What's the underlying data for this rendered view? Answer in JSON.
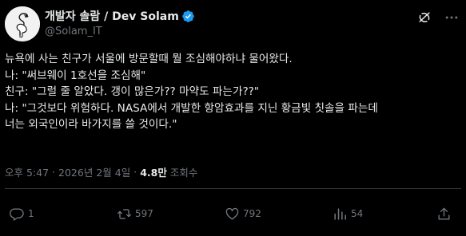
{
  "author": {
    "display_name": "개발자 솔람 / Dev Solam",
    "handle": "@Solam_IT",
    "verified": true,
    "verified_color": "#1d9bf0"
  },
  "tweet": {
    "lines": [
      "뉴욕에 사는 친구가 서울에 방문할때 뭘 조심해야하냐 물어왔다.",
      "나: \"써브웨이 1호선을 조심해\"",
      "친구: \"그럴 줄 알았다. 갱이 많은가?? 마약도 파는가??\"",
      "나: \"그것보다 위험하다. NASA에서 개발한 항암효과를 지닌 황금빛 칫솔을 파는데",
      "너는 외국인이라 바가지를 쓸 것이다.\""
    ]
  },
  "meta": {
    "time": "오후 5:47",
    "date": "2026년 2월 4일",
    "views_count": "4.8만",
    "views_label": "조회수",
    "separator": "·"
  },
  "actions": {
    "reply_count": "1",
    "retweet_count": "597",
    "like_count": "792",
    "views_count": "54",
    "share_count": ""
  },
  "icons": {
    "grok": "grok-icon",
    "more": "more-icon",
    "reply": "reply-icon",
    "retweet": "retweet-icon",
    "like": "heart-icon",
    "views": "views-icon",
    "share": "share-icon"
  },
  "colors": {
    "background": "#000000",
    "text": "#e7e9ea",
    "secondary": "#71767b",
    "border": "#2f3336"
  }
}
